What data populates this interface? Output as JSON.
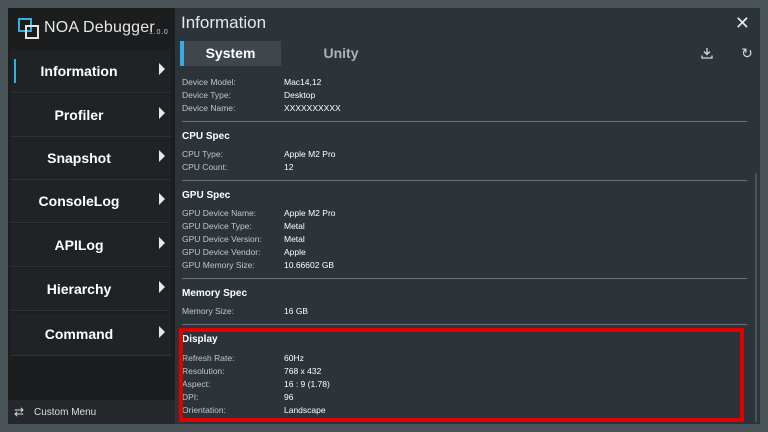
{
  "app": {
    "name": "NOA Debugger",
    "version": "1.0.0",
    "logo_icon": "noa-logo-icon",
    "colors": {
      "accent": "#32aee0",
      "highlight": "#e00000"
    }
  },
  "sidebar": {
    "items": [
      {
        "label": "Information",
        "active": true
      },
      {
        "label": "Profiler"
      },
      {
        "label": "Snapshot"
      },
      {
        "label": "ConsoleLog"
      },
      {
        "label": "APILog"
      },
      {
        "label": "Hierarchy"
      },
      {
        "label": "Command"
      }
    ],
    "custom_menu": "Custom Menu",
    "custom_menu_icon": "swap-arrows-icon"
  },
  "main": {
    "title": "Information",
    "tabs": [
      {
        "label": "System",
        "active": true
      },
      {
        "label": "Unity"
      }
    ],
    "download_icon": "download-icon",
    "refresh_icon": "refresh-icon",
    "close_icon": "close-icon"
  },
  "device_rows": [
    {
      "key": "Device Model:",
      "value": "Mac14,12"
    },
    {
      "key": "Device Type:",
      "value": "Desktop"
    },
    {
      "key": "Device Name:",
      "value": "XXXXXXXXXX"
    }
  ],
  "cpu": {
    "title": "CPU Spec",
    "rows": [
      {
        "key": "CPU Type:",
        "value": "Apple M2 Pro"
      },
      {
        "key": "CPU Count:",
        "value": "12"
      }
    ]
  },
  "gpu": {
    "title": "GPU Spec",
    "rows": [
      {
        "key": "GPU Device Name:",
        "value": "Apple M2 Pro"
      },
      {
        "key": "GPU Device Type:",
        "value": "Metal"
      },
      {
        "key": "GPU Device Version:",
        "value": "Metal"
      },
      {
        "key": "GPU Device Vendor:",
        "value": "Apple"
      },
      {
        "key": "GPU Memory Size:",
        "value": "10.66602 GB"
      }
    ]
  },
  "memory": {
    "title": "Memory Spec",
    "rows": [
      {
        "key": "Memory Size:",
        "value": "16 GB"
      }
    ]
  },
  "display": {
    "title": "Display",
    "rows": [
      {
        "key": "Refresh Rate:",
        "value": "60Hz"
      },
      {
        "key": "Resolution:",
        "value": "768 x 432"
      },
      {
        "key": "Aspect:",
        "value": "16 : 9 (1.78)"
      },
      {
        "key": "DPI:",
        "value": "96"
      },
      {
        "key": "Orientation:",
        "value": "Landscape"
      }
    ]
  }
}
